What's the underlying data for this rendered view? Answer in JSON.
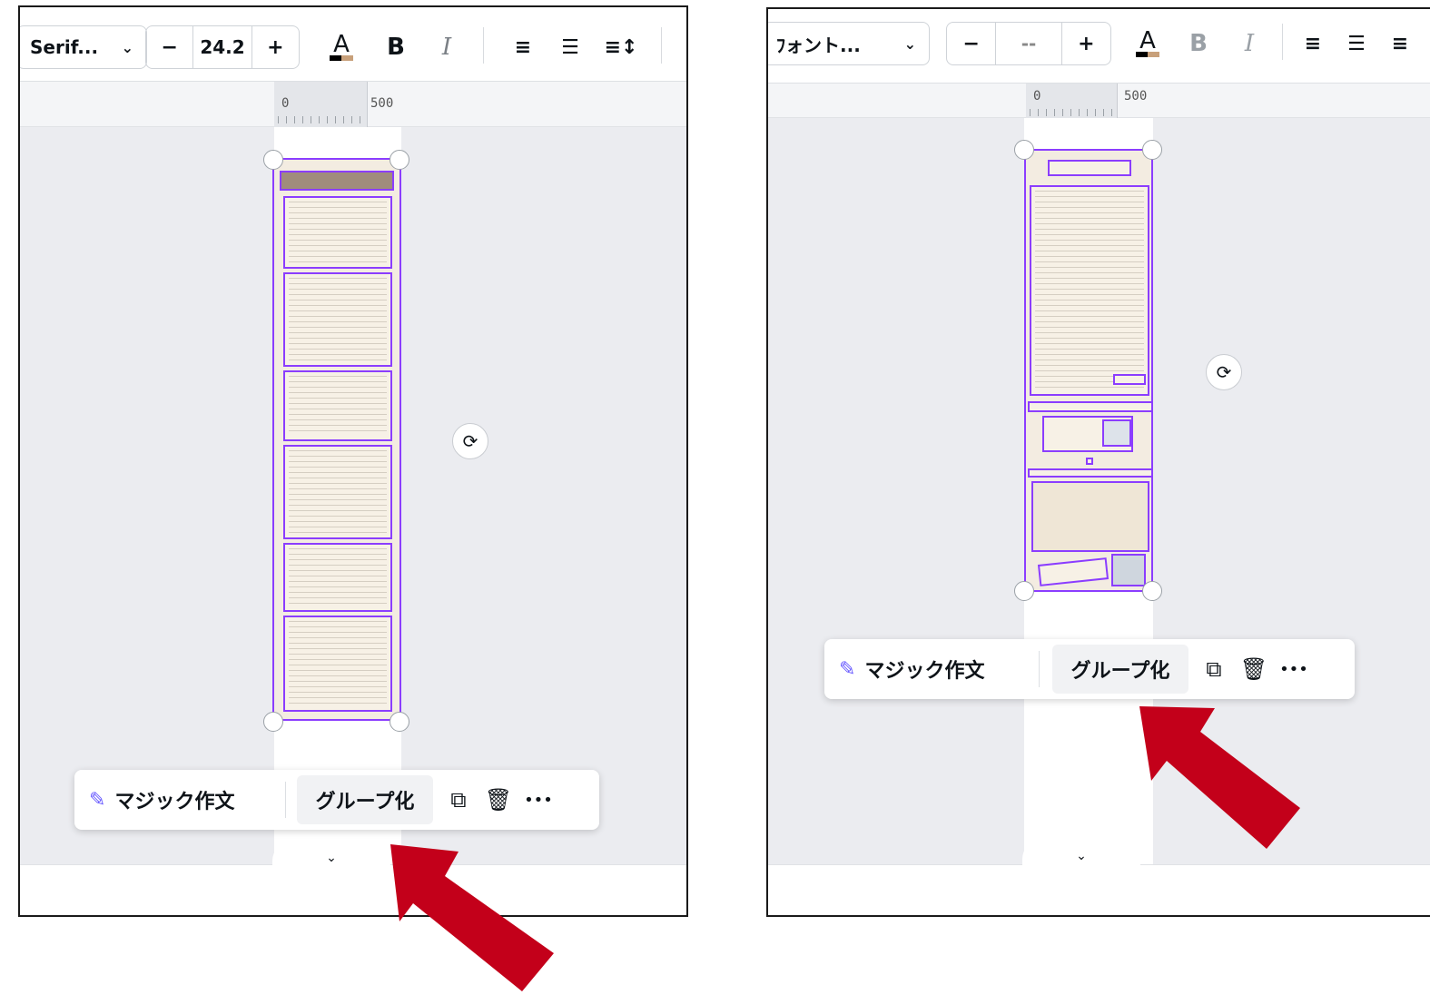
{
  "left": {
    "font_name": "Serif...",
    "font_size": "24.2",
    "minus": "−",
    "plus": "+",
    "color_letter": "A",
    "bold": "B",
    "italic": "I",
    "ruler_zero": "0",
    "ruler_500": "500",
    "magic": "マジック作文",
    "group": "グループ化",
    "more": "•••"
  },
  "right": {
    "font_name": "ﾌォント...",
    "font_size": "--",
    "minus": "−",
    "plus": "+",
    "color_letter": "A",
    "bold": "B",
    "italic": "I",
    "ruler_zero": "0",
    "ruler_500": "500",
    "magic": "マジック作文",
    "group": "グループ化",
    "more": "•••"
  },
  "colors": {
    "selection": "#8b3dff",
    "arrow": "#c3001a",
    "canvas": "#ebecf0"
  },
  "icons": [
    "chevron-down-icon",
    "text-color-icon",
    "bold-icon",
    "italic-icon",
    "align-center-icon",
    "list-icon",
    "spacing-icon",
    "rotate-icon",
    "magic-wand-icon",
    "duplicate-icon",
    "trash-icon",
    "more-icon",
    "arrow-icon"
  ]
}
